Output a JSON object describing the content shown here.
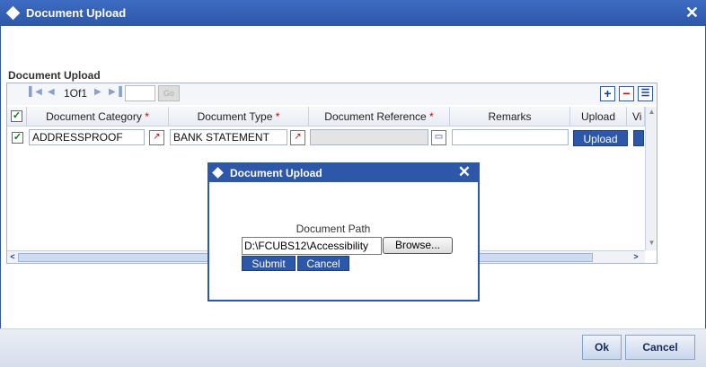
{
  "window": {
    "title": "Document Upload"
  },
  "section": {
    "label": "Document Upload"
  },
  "pager": {
    "page_text": "1Of1",
    "go_label": "Go"
  },
  "grid": {
    "headers": [
      "Document Category",
      "Document Type",
      "Document Reference",
      "Remarks",
      "Upload",
      "Vi"
    ],
    "required_mark": "*",
    "row": {
      "category": "ADDRESSPROOF",
      "type": "BANK STATEMENT",
      "reference": "",
      "remarks": "",
      "upload_label": "Upload"
    }
  },
  "dialog": {
    "title": "Document Upload",
    "field_label": "Document Path",
    "path_value": "D:\\FCUBS12\\Accessibility",
    "browse_label": "Browse...",
    "submit_label": "Submit",
    "cancel_label": "Cancel"
  },
  "footer": {
    "ok_label": "Ok",
    "cancel_label": "Cancel"
  },
  "colors": {
    "accent": "#2d57a8",
    "required": "#cc0000"
  }
}
